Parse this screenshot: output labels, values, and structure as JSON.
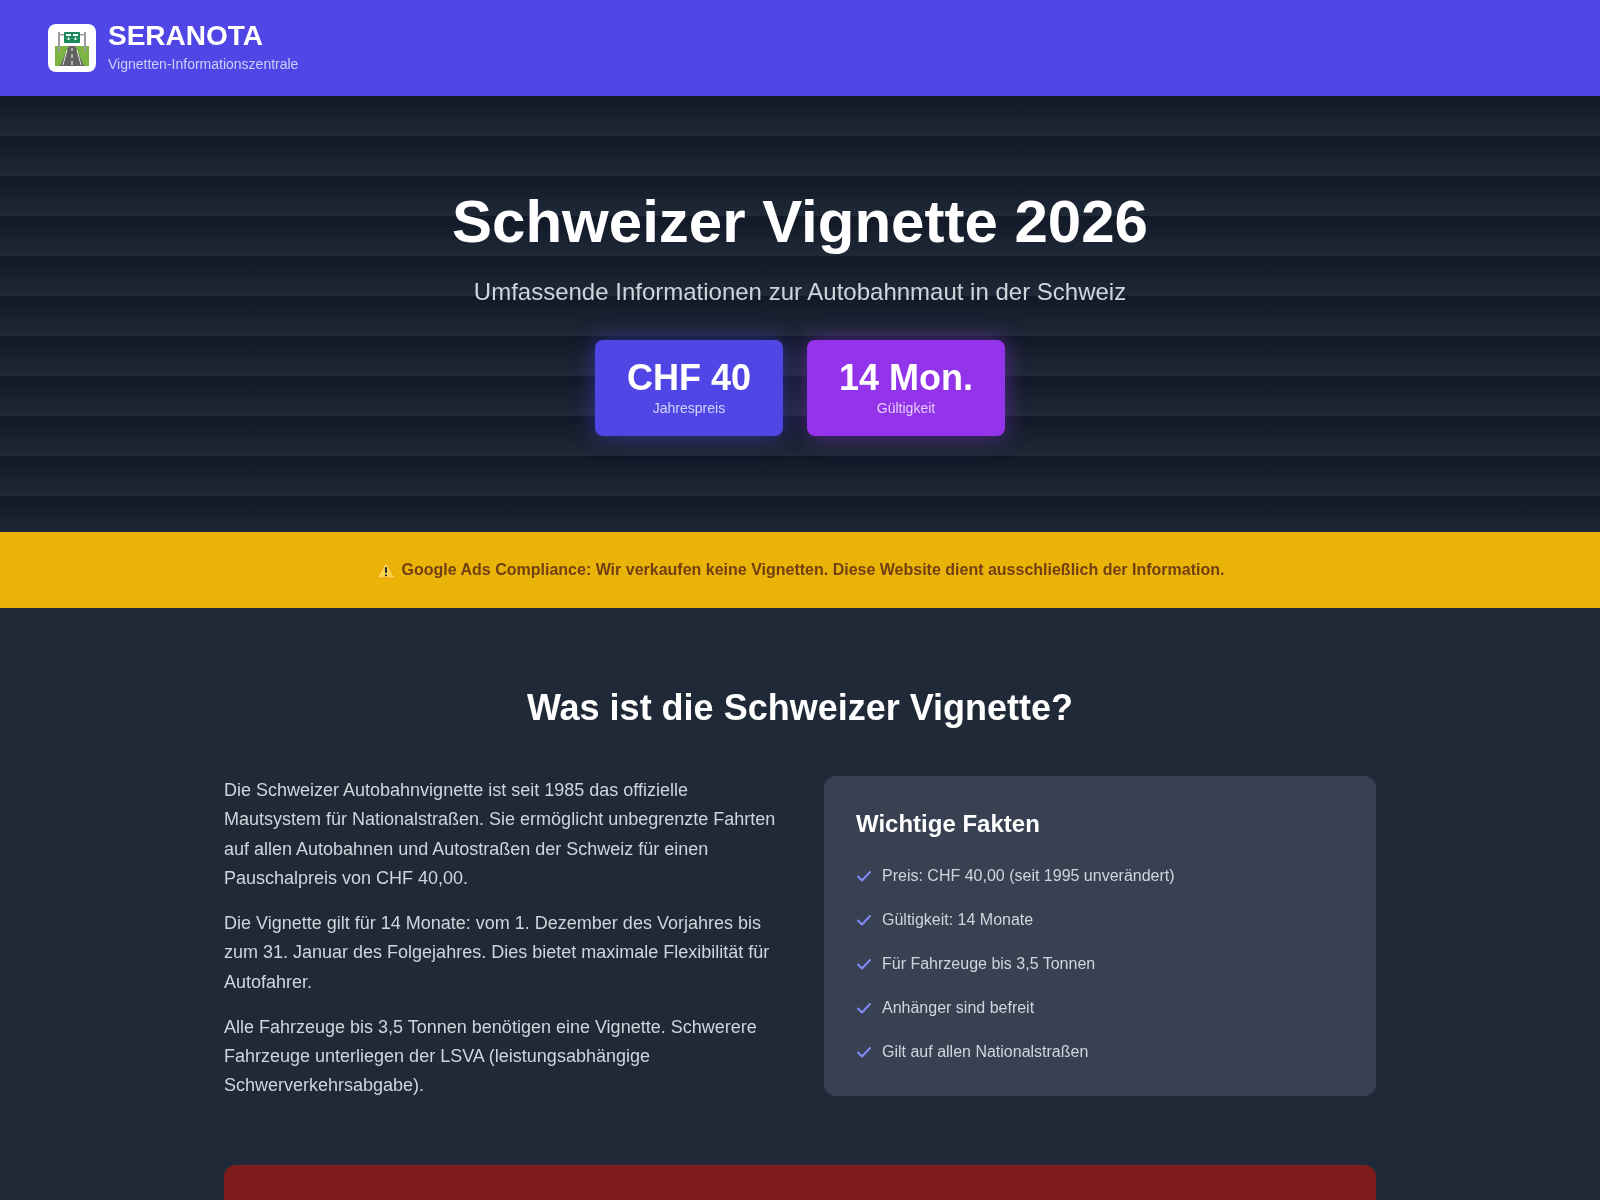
{
  "header": {
    "title": "SERANOTA",
    "subtitle": "Vignetten-Informationszentrale"
  },
  "hero": {
    "title": "Schweizer Vignette 2026",
    "subtitle": "Umfassende Informationen zur Autobahnmaut in der Schweiz",
    "stats": [
      {
        "value": "CHF 40",
        "label": "Jahrespreis",
        "color": "#4f46e5"
      },
      {
        "value": "14 Mon.",
        "label": "Gültigkeit",
        "color": "#9333ea"
      }
    ]
  },
  "notice_bar": {
    "text": "Google Ads Compliance: Wir verkaufen keine Vignetten. Diese Website dient ausschließlich der Information."
  },
  "about": {
    "heading": "Was ist die Schweizer Vignette?",
    "paragraphs": [
      "Die Schweizer Autobahnvignette ist seit 1985 das offizielle Mautsystem für Nationalstraßen. Sie ermöglicht unbegrenzte Fahrten auf allen Autobahnen und Autostraßen der Schweiz für einen Pauschalpreis von CHF 40,00.",
      "Die Vignette gilt für 14 Monate: vom 1. Dezember des Vorjahres bis zum 31. Januar des Folgejahres. Dies bietet maximale Flexibilität für Autofahrer.",
      "Alle Fahrzeuge bis 3,5 Tonnen benötigen eine Vignette. Schwerere Fahrzeuge unterliegen der LSVA (leistungsabhängige Schwerverkehrsabgabe)."
    ],
    "facts": {
      "title": "Wichtige Fakten",
      "items": [
        "Preis: CHF 40,00 (seit 1995 unverändert)",
        "Gültigkeit: 14 Monate",
        "Für Fahrzeuge bis 3,5 Tonnen",
        "Anhänger sind befreit",
        "Gilt auf allen Nationalstraßen"
      ]
    }
  }
}
